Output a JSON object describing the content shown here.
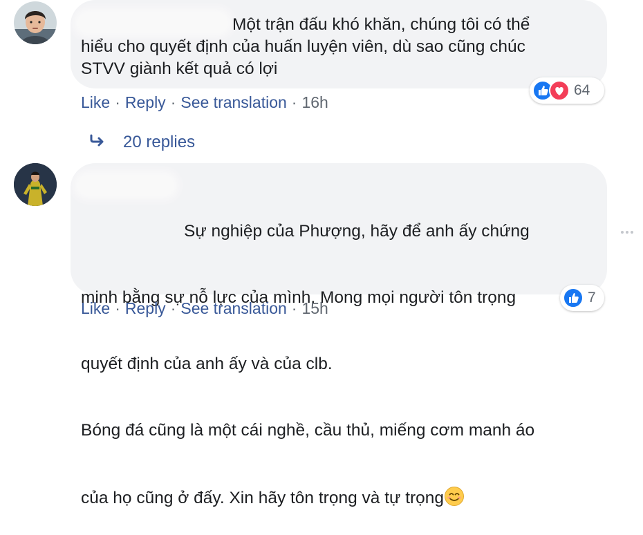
{
  "comments": [
    {
      "text": "Một trận đấu khó khăn, chúng tôi có thể\nhiểu cho quyết định của huấn luyện viên, dù sao cũng chúc\nSTVV giành kết quả có lợi",
      "actions": {
        "like": "Like",
        "reply": "Reply",
        "see_translation": "See translation",
        "time": "16h"
      },
      "reactions": {
        "icons": [
          "like-reaction",
          "love-reaction"
        ],
        "count": "64"
      }
    },
    {
      "text_lines": [
        "Sự nghiệp của Phượng, hãy để anh ấy chứng",
        "minh bằng sự nỗ lực của mình. Mong mọi người tôn trọng",
        "quyết định của anh ấy và của clb.",
        "Bóng đá cũng là một cái nghề, cầu thủ, miếng cơm manh áo",
        "của họ cũng ở đấy. Xin hãy tôn trọng và tự trọng"
      ],
      "emoji": "smiling-face",
      "actions": {
        "like": "Like",
        "reply": "Reply",
        "see_translation": "See translation",
        "time": "15h"
      },
      "reactions": {
        "icons": [
          "like-reaction"
        ],
        "count": "7"
      }
    }
  ],
  "replies": {
    "label": "20 replies",
    "icon": "reply-arrow-icon"
  },
  "colors": {
    "link": "#385898",
    "meta": "#606770",
    "bubble": "#f2f3f5",
    "like_blue": "#1877f2",
    "love_red": "#f33e58"
  }
}
